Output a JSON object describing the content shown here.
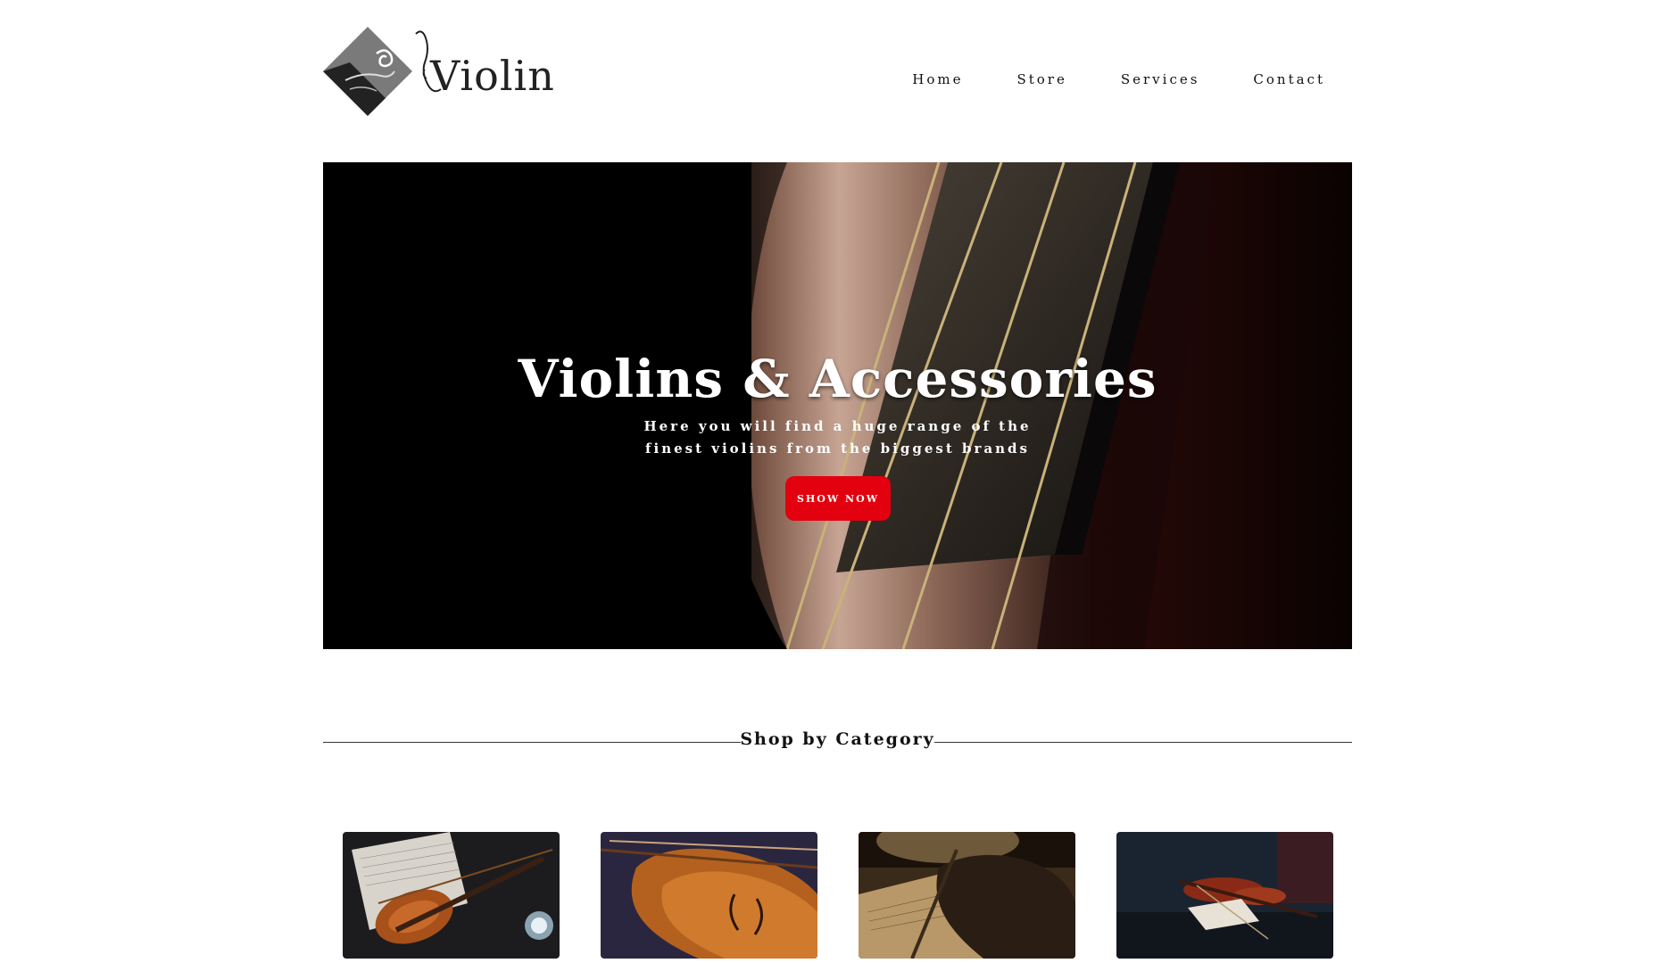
{
  "brand": {
    "name": "Violin"
  },
  "nav": {
    "items": [
      "Home",
      "Store",
      "Services",
      "Contact"
    ]
  },
  "hero": {
    "title": "Violins & Accessories",
    "subtitle_line1": "Here you will find a huge range of the",
    "subtitle_line2": "finest violins from the biggest brands",
    "button_label": "SHOW NOW"
  },
  "section": {
    "title": "Shop by Category"
  },
  "colors": {
    "accent": "#e3000f",
    "hero_bg": "#000000"
  }
}
